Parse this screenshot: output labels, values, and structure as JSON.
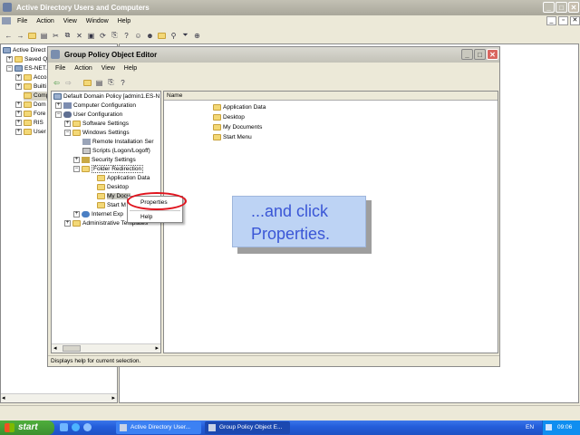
{
  "bg_window": {
    "title": "Active Directory Users and Computers",
    "menu": [
      "File",
      "Action",
      "View",
      "Window",
      "Help"
    ],
    "tree": [
      "Active Direct",
      "Saved Q",
      "ES-NET.C",
      "Acco",
      "Builti",
      "Comp",
      "Dom",
      "Fore",
      "RIS",
      "User"
    ]
  },
  "gpo_window": {
    "title": "Group Policy Object Editor",
    "menu": [
      "File",
      "Action",
      "View",
      "Help"
    ],
    "tree": [
      {
        "label": "Default Domain Policy [admin1.ES-N"
      },
      {
        "label": "Computer Configuration"
      },
      {
        "label": "User Configuration"
      },
      {
        "label": "Software Settings"
      },
      {
        "label": "Windows Settings"
      },
      {
        "label": "Remote Installation Ser"
      },
      {
        "label": "Scripts (Logon/Logoff)"
      },
      {
        "label": "Security Settings"
      },
      {
        "label": "Folder Redirection"
      },
      {
        "label": "Application Data"
      },
      {
        "label": "Desktop"
      },
      {
        "label": "My Docu"
      },
      {
        "label": "Start M"
      },
      {
        "label": "Internet Exp"
      },
      {
        "label": "Administrative Templates"
      }
    ],
    "list_header": "Name",
    "list_items": [
      "Application Data",
      "Desktop",
      "My Documents",
      "Start Menu"
    ],
    "status": "Displays help for current selection."
  },
  "context_menu": {
    "items": [
      "Properties",
      "Help"
    ]
  },
  "callout": {
    "line1": "...and click",
    "line2": "Properties."
  },
  "taskbar": {
    "start": "start",
    "tasks": [
      "Active Directory User...",
      "Group Policy Object E..."
    ],
    "lang": "EN",
    "clock": "09:06"
  },
  "colors": {
    "titlebar": "#0a246a",
    "accent_red": "#e0141e",
    "taskbar": "#245edb",
    "start": "#3c8f2f",
    "callout_text": "#3a56d6"
  }
}
